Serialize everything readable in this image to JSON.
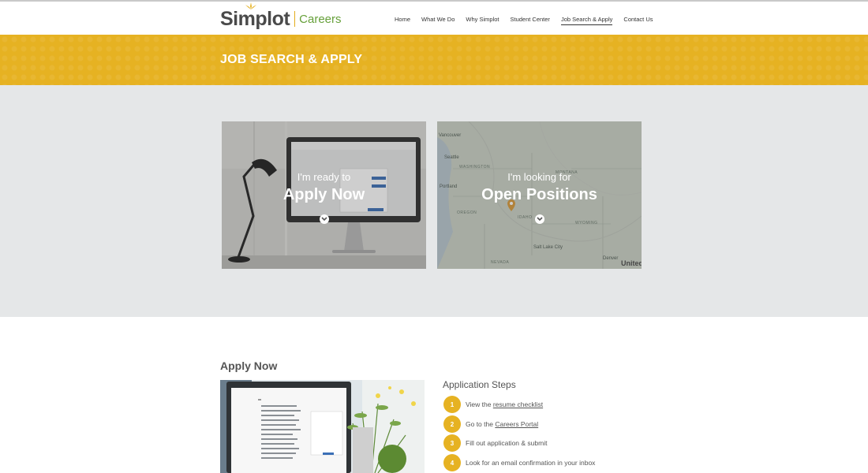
{
  "brand": {
    "name": "Simplot",
    "sub": "Careers"
  },
  "nav": {
    "items": [
      "Home",
      "What We Do",
      "Why Simplot",
      "Student Center",
      "Job Search & Apply",
      "Contact Us"
    ],
    "active_index": 4
  },
  "banner": {
    "title": "JOB SEARCH & APPLY"
  },
  "cards": {
    "apply": {
      "pre": "I'm ready to",
      "main": "Apply Now"
    },
    "open": {
      "pre": "I'm looking for",
      "main": "Open Positions"
    }
  },
  "map": {
    "states": [
      "WASHINGTON",
      "MONTANA",
      "OREGON",
      "IDAHO",
      "WYOMING",
      "NEVADA"
    ],
    "cities": [
      "Vancouver",
      "Seattle",
      "Portland",
      "Salt Lake City",
      "Denver"
    ],
    "brand": "United"
  },
  "apply_section": {
    "heading": "Apply Now"
  },
  "steps": {
    "title": "Application Steps",
    "items": [
      {
        "num": "1",
        "pre": "View the ",
        "link": "resume checklist",
        "post": ""
      },
      {
        "num": "2",
        "pre": "Go to the ",
        "link": "Careers Portal",
        "post": ""
      },
      {
        "num": "3",
        "pre": "Fill out application & submit",
        "link": "",
        "post": ""
      },
      {
        "num": "4",
        "pre": "Look for an email confirmation in your inbox",
        "link": "",
        "post": ""
      }
    ]
  },
  "colors": {
    "accent": "#e6b222",
    "green": "#66a03a",
    "gray_band": "#e5e7e8"
  }
}
